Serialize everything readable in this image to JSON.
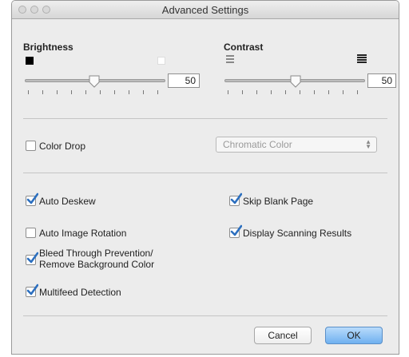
{
  "window": {
    "title": "Advanced Settings"
  },
  "brightness": {
    "label": "Brightness",
    "value": "50",
    "slider_fraction": 0.5
  },
  "contrast": {
    "label": "Contrast",
    "value": "50",
    "slider_fraction": 0.5
  },
  "color_drop": {
    "label": "Color Drop",
    "checked": false,
    "select_value": "Chromatic Color"
  },
  "options": {
    "auto_deskew": {
      "label": "Auto Deskew",
      "checked": true
    },
    "skip_blank_page": {
      "label": "Skip Blank Page",
      "checked": true
    },
    "auto_image_rotation": {
      "label": "Auto Image Rotation",
      "checked": false
    },
    "display_scanning_results": {
      "label": "Display Scanning Results",
      "checked": true
    },
    "bleed_through_line1": "Bleed Through Prevention/",
    "bleed_through_line2": "Remove Background Color",
    "bleed_through_checked": true,
    "multifeed_detection": {
      "label": "Multifeed Detection",
      "checked": true
    }
  },
  "buttons": {
    "cancel": "Cancel",
    "ok": "OK"
  },
  "colors": {
    "accent_check": "#2c6fbf",
    "ok_button": "#6fb1f0"
  }
}
